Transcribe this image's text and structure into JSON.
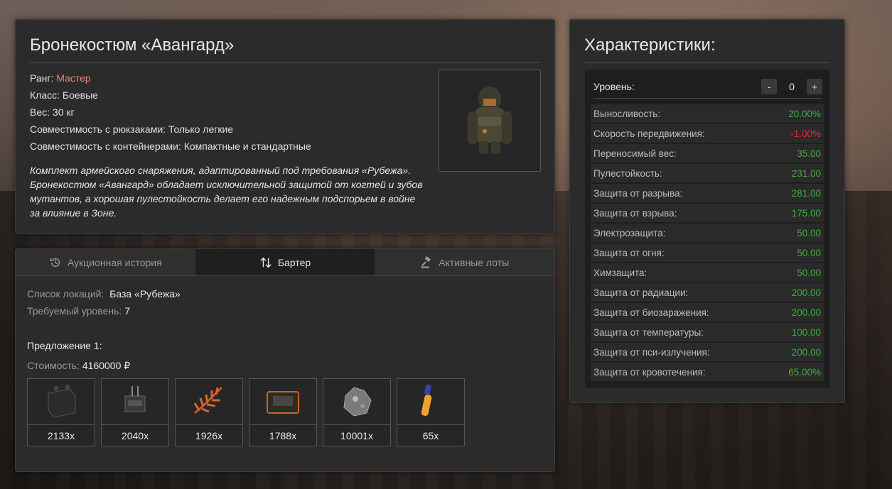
{
  "item": {
    "title": "Бронекостюм «Авангард»",
    "rank_label": "Ранг:",
    "rank_value": "Мастер",
    "class": "Класс: Боевые",
    "weight": "Вес: 30 кг",
    "backpacks": "Совместимость с рюкзаками: Только легкие",
    "containers": "Совместимость с контейнерами: Компактные и стандартные",
    "description": "Комплект армейского снаряжения, адаптированный под требования «Рубежа». Бронекостюм «Авангард» обладает исключительной защитой от когтей и зубов мутантов, а хорошая пулестойкость делает его надежным подспорьем в войне за влияние в Зоне.",
    "image_icon": "armor-suit-icon"
  },
  "tabs": [
    {
      "label": "Аукционная история",
      "icon": "history-icon"
    },
    {
      "label": "Бартер",
      "icon": "swap-arrows-icon"
    },
    {
      "label": "Активные лоты",
      "icon": "gavel-icon"
    }
  ],
  "barter": {
    "locations_label": "Список локаций:",
    "locations_value": "База «Рубежа»",
    "level_label": "Требуемый уровень:",
    "level_value": "7",
    "offer_title": "Предложение 1:",
    "cost_label": "Стоимость:",
    "cost_value": "4160000 ₽",
    "items": [
      {
        "qty": "2133x",
        "icon": "battery-icon"
      },
      {
        "qty": "2040x",
        "icon": "device-icon"
      },
      {
        "qty": "1926x",
        "icon": "fern-icon"
      },
      {
        "qty": "1788x",
        "icon": "case-icon"
      },
      {
        "qty": "10001x",
        "icon": "ore-icon"
      },
      {
        "qty": "65x",
        "icon": "vial-icon"
      }
    ]
  },
  "stats": {
    "title": "Характеристики:",
    "level_label": "Уровень:",
    "level_minus": "-",
    "level_value": "0",
    "level_plus": "+",
    "rows": [
      {
        "name": "Выносливость:",
        "value": "20.00%"
      },
      {
        "name": "Скорость передвижения:",
        "value": "-1.00%"
      },
      {
        "name": "Переносимый вес:",
        "value": "35.00"
      },
      {
        "name": "Пулестойкость:",
        "value": "231.00"
      },
      {
        "name": "Защита от разрыва:",
        "value": "281.00"
      },
      {
        "name": "Защита от взрыва:",
        "value": "175.00"
      },
      {
        "name": "Электрозащита:",
        "value": "50.00"
      },
      {
        "name": "Защита от огня:",
        "value": "50.00"
      },
      {
        "name": "Химзащита:",
        "value": "50.00"
      },
      {
        "name": "Защита от радиации:",
        "value": "200.00"
      },
      {
        "name": "Защита от биозаражения:",
        "value": "200.00"
      },
      {
        "name": "Защита от температуры:",
        "value": "100.00"
      },
      {
        "name": "Защита от пси-излучения:",
        "value": "200.00"
      },
      {
        "name": "Защита от кровотечения:",
        "value": "65.00%"
      }
    ]
  },
  "colors": {
    "positive": "#3fae3f",
    "negative": "#e32b2b",
    "rank": "#e8897a"
  }
}
